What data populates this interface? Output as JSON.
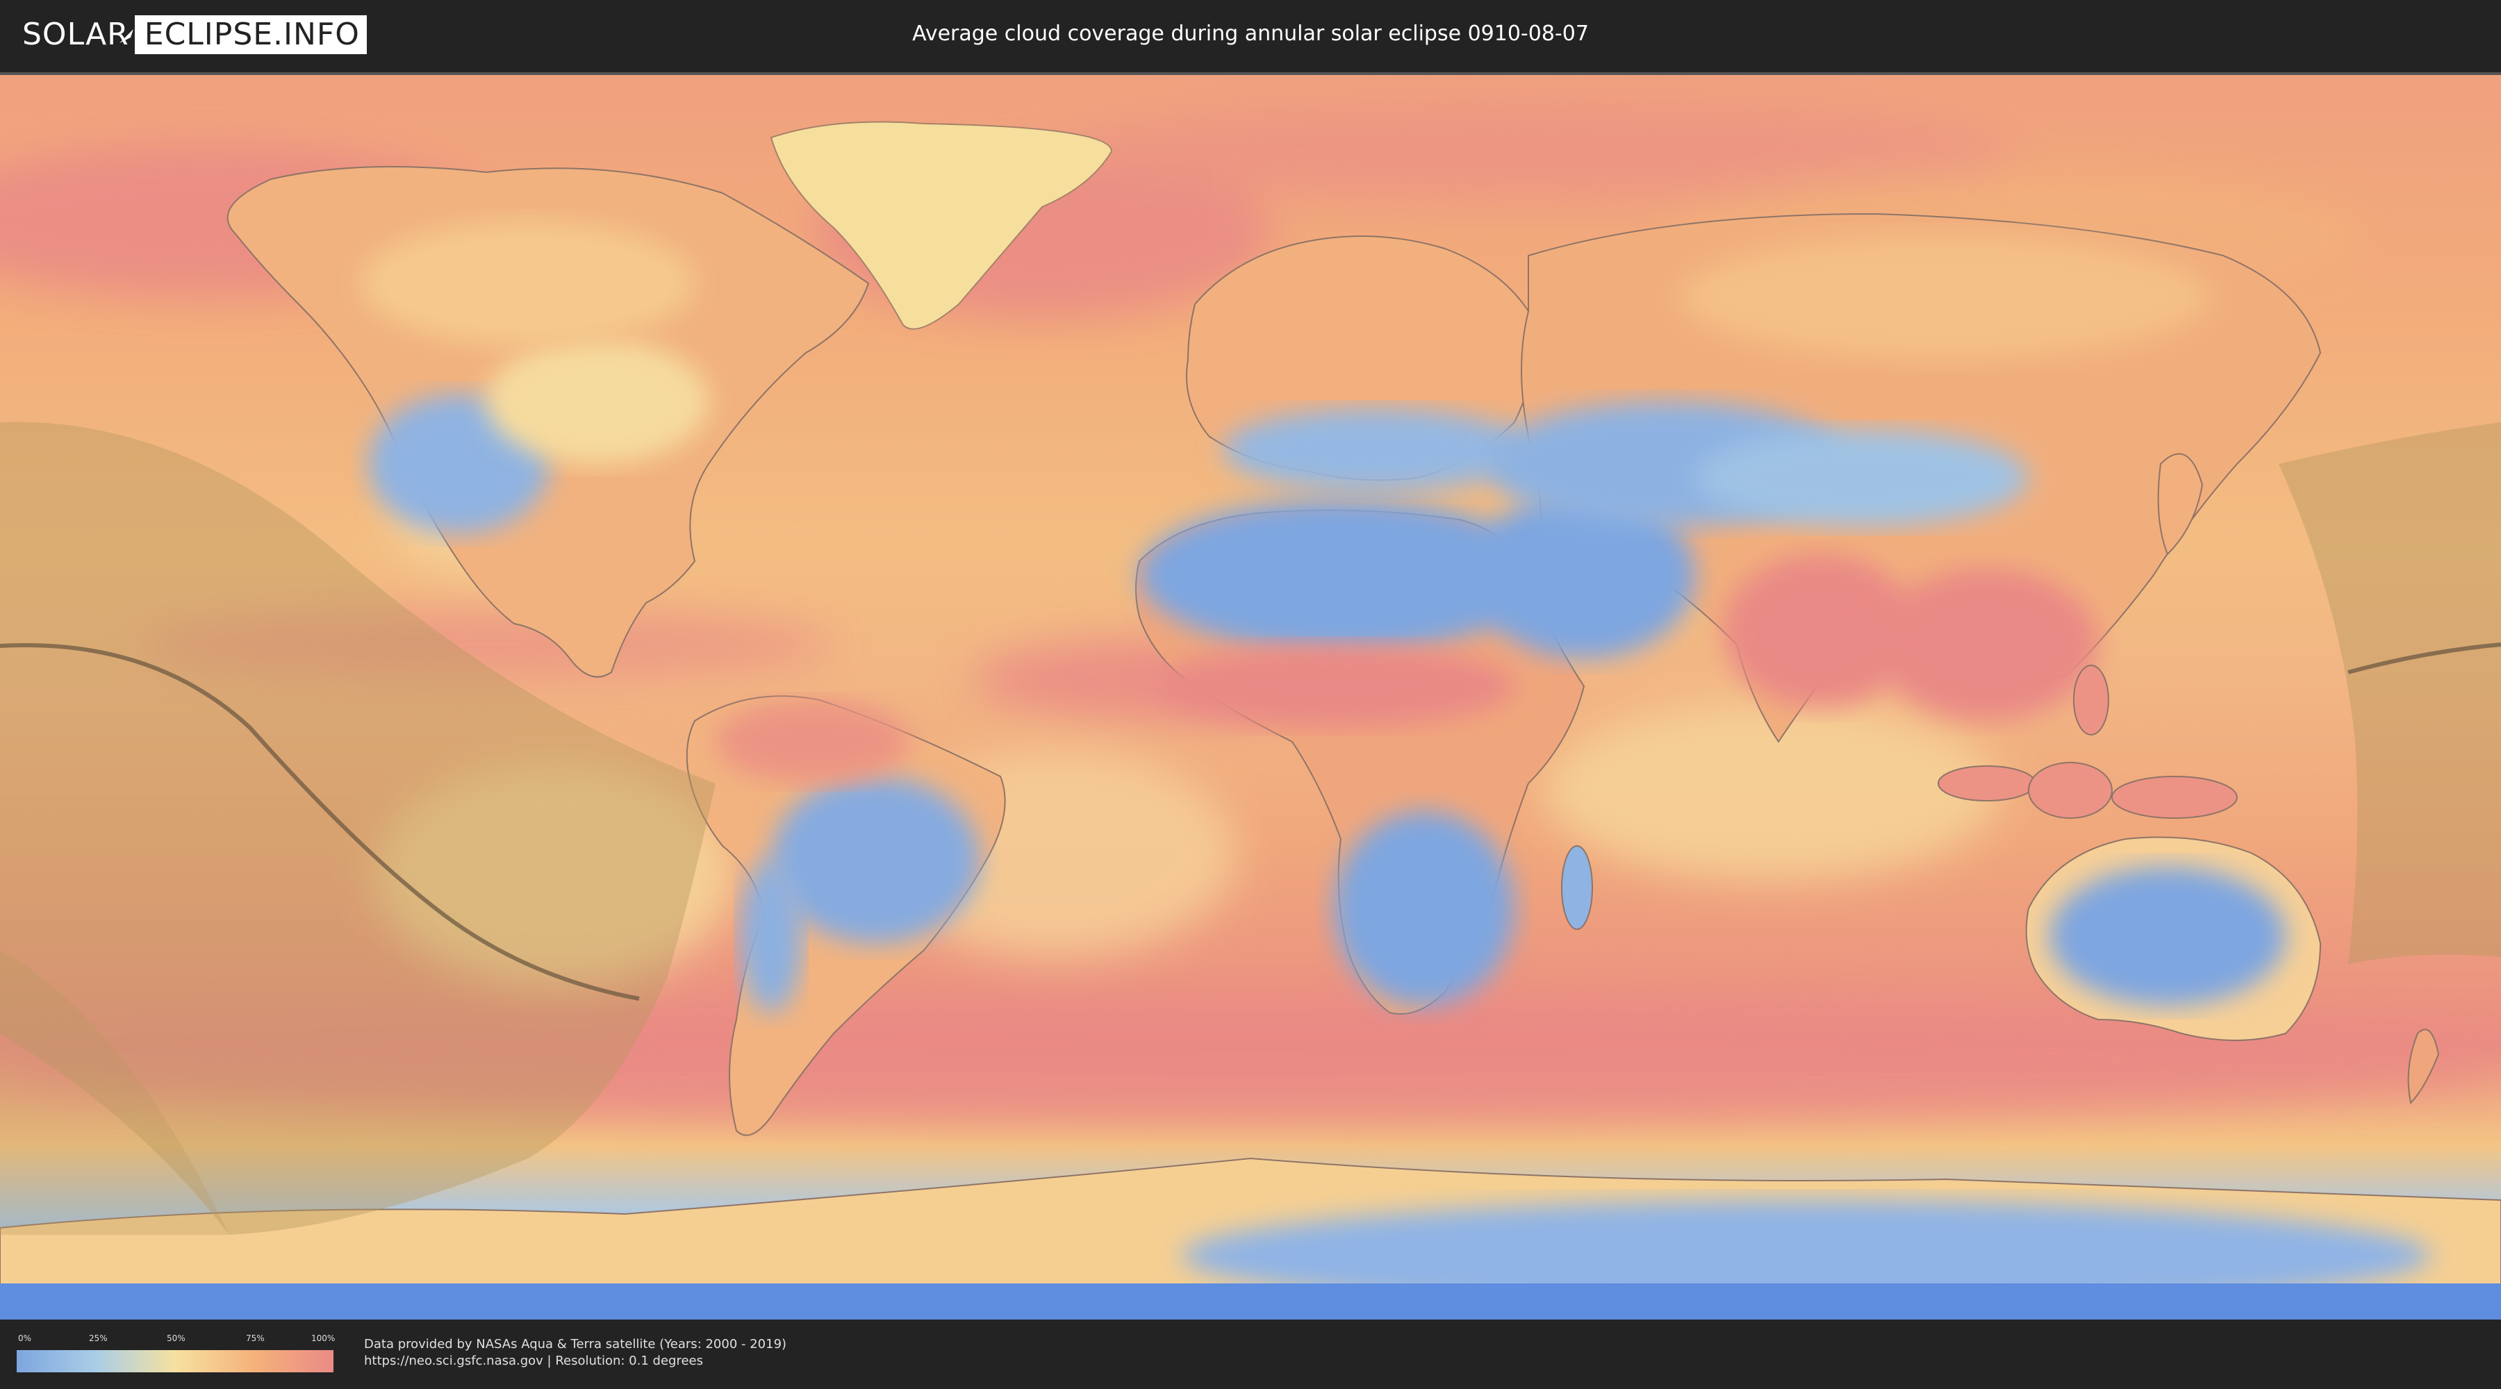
{
  "header": {
    "logo_left": "SOLAR",
    "logo_right": "ECLIPSE.INFO",
    "title": "Average cloud coverage during annular solar eclipse 0910-08-07"
  },
  "map": {
    "palette": {
      "ocean_base": "#f1ab7d",
      "clear": "#7ea6e0",
      "light": "#a9cde6",
      "mid": "#f6e1a0",
      "high": "#f4b27a",
      "overcast": "#ea8a86",
      "shadow": "#b89860",
      "eclipse_path": "#6e5a42",
      "borders": "#8f7467"
    }
  },
  "legend": {
    "ticks": [
      "0%",
      "25%",
      "50%",
      "75%",
      "100%"
    ]
  },
  "footer": {
    "credit_line1": "Data provided by NASAs Aqua & Terra satellite (Years: 2000 - 2019)",
    "credit_line2": "https://neo.sci.gsfc.nasa.gov | Resolution: 0.1 degrees"
  }
}
